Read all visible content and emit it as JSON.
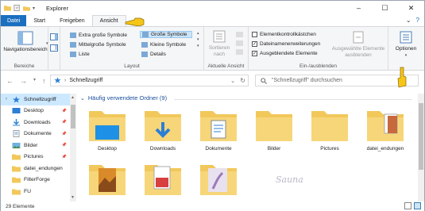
{
  "window": {
    "title": "Explorer"
  },
  "tabs": [
    {
      "label": "Datei"
    },
    {
      "label": "Start"
    },
    {
      "label": "Freigeben"
    },
    {
      "label": "Ansicht"
    }
  ],
  "ribbon": {
    "panes": {
      "nav_label": "Navigationsbereich",
      "group": "Bereiche"
    },
    "layout": {
      "group": "Layout",
      "items": [
        "Extra große Symbole",
        "Große Symbole",
        "Mittelgroße Symbole",
        "Kleine Symbole",
        "Liste",
        "Details"
      ]
    },
    "current_view": {
      "sort_label": "Sortieren nach",
      "group": "Aktuelle Ansicht"
    },
    "show_hide": {
      "group": "Ein-/ausblenden",
      "options": [
        {
          "label": "Elementkontrollkästchen",
          "checked": false
        },
        {
          "label": "Dateinamenerweiterungen",
          "checked": true
        },
        {
          "label": "Ausgeblendete Elemente",
          "checked": true
        }
      ],
      "hide_selected": "Ausgewählte Elemente ausblenden"
    },
    "options": {
      "label": "Optionen"
    }
  },
  "address": {
    "path": "Schnellzugriff",
    "search_placeholder": "\"Schnellzugriff\" durchsuchen"
  },
  "nav": {
    "items": [
      {
        "label": "Schnellzugriff",
        "icon": "star-icon",
        "pinned": false
      },
      {
        "label": "Desktop",
        "icon": "desktop-icon",
        "pinned": true
      },
      {
        "label": "Downloads",
        "icon": "downloads-icon",
        "pinned": true
      },
      {
        "label": "Dokumente",
        "icon": "documents-icon",
        "pinned": true
      },
      {
        "label": "Bilder",
        "icon": "pictures-icon",
        "pinned": true
      },
      {
        "label": "Pictures",
        "icon": "folder-icon",
        "pinned": true
      },
      {
        "label": "datei_endungen",
        "icon": "folder-icon",
        "pinned": false
      },
      {
        "label": "FilterForge",
        "icon": "folder-icon",
        "pinned": false
      },
      {
        "label": "FU",
        "icon": "folder-icon",
        "pinned": false
      }
    ]
  },
  "content": {
    "section_title": "Häufig verwendete Ordner (9)",
    "folders": [
      {
        "label": "Desktop"
      },
      {
        "label": "Downloads"
      },
      {
        "label": "Dokumente"
      },
      {
        "label": "Bilder"
      },
      {
        "label": "Pictures"
      },
      {
        "label": "datei_endungen"
      },
      {
        "label": ""
      },
      {
        "label": ""
      },
      {
        "label": ""
      }
    ],
    "watermark": "Sauna"
  },
  "status": {
    "count": "29 Elemente"
  },
  "colors": {
    "accent": "#1a6fc0",
    "folder": "#f2c85b",
    "selected": "#cce8ff"
  }
}
